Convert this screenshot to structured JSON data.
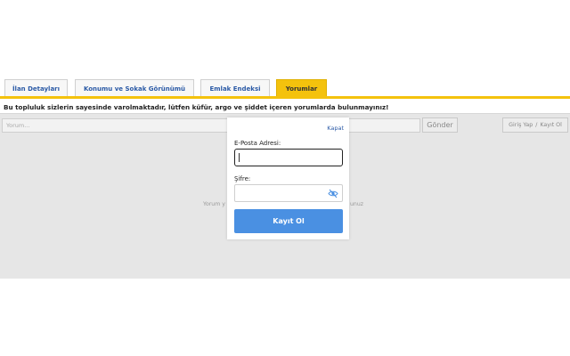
{
  "tabs": [
    {
      "label": "İlan Detayları"
    },
    {
      "label": "Konumu ve Sokak Görünümü"
    },
    {
      "label": "Emlak Endeksi"
    },
    {
      "label": "Yorumlar",
      "active": true
    }
  ],
  "notice": "Bu topluluk sizlerin sayesinde varolmaktadır, lütfen küfür, argo ve şiddet içeren yorumlarda bulunmayınız!",
  "comment": {
    "placeholder": "Yorum...",
    "send_label": "Gönder",
    "login_label": "Giriş Yap",
    "separator": "/",
    "register_label": "Kayıt Ol",
    "empty_left": "Yorum y",
    "empty_right": "unuz"
  },
  "modal": {
    "close_label": "Kapat",
    "email_label": "E-Posta Adresi:",
    "email_value": "",
    "password_label": "Şifre:",
    "password_value": "",
    "submit_label": "Kayıt Ol"
  },
  "colors": {
    "accent": "#f4c20d",
    "link": "#2b5aa6",
    "primary_button": "#4a90e2"
  }
}
